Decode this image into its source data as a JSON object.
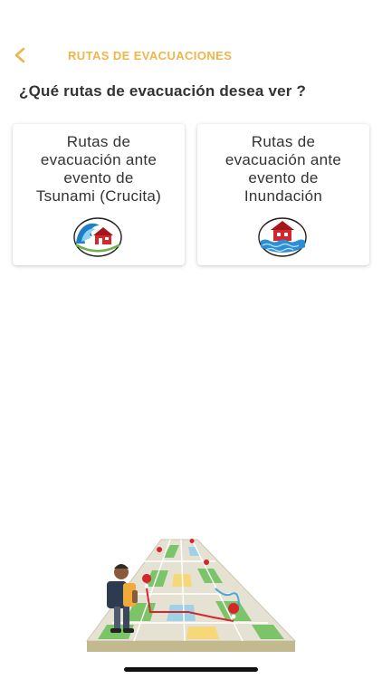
{
  "header": {
    "title": "RUTAS DE EVACUACIONES",
    "back_icon": "chevron-left-icon",
    "accent_color": "#f0b54a"
  },
  "question": "¿Qué rutas de evacuación desea ver ?",
  "cards": [
    {
      "label": "Rutas de\nevacuación ante\nevento de\nTsunami (Crucita)",
      "icon": "tsunami-house-icon"
    },
    {
      "label": "Rutas de\nevacuación ante\nevento de\nInundación",
      "icon": "flood-house-icon"
    }
  ],
  "illustration": "person-with-map-route-illustration"
}
